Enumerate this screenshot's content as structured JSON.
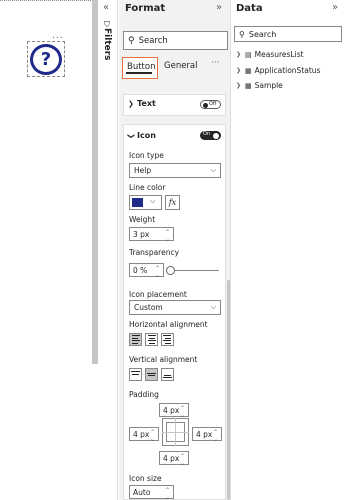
{
  "canvas": {
    "visual_more": "...",
    "help_glyph": "?"
  },
  "filters": {
    "collapse_glyph": "«",
    "label": "Filters",
    "icon_glyph": "⛉"
  },
  "format_pane": {
    "title": "Format",
    "expand_glyph": "»",
    "search_placeholder": "Search",
    "tabs": [
      {
        "label": "Button",
        "selected": true
      },
      {
        "label": "General",
        "selected": false
      }
    ],
    "more_glyph": "···",
    "text_card": {
      "label": "Text",
      "toggle": "Off"
    },
    "icon_card": {
      "label": "Icon",
      "toggle": "On",
      "icon_type": {
        "label": "Icon type",
        "value": "Help"
      },
      "line_color": {
        "label": "Line color",
        "color": "#1f2a8a",
        "fx_label": "fx"
      },
      "weight": {
        "label": "Weight",
        "value": "3 px"
      },
      "transparency": {
        "label": "Transparency",
        "value": "0 %",
        "level": 0
      },
      "icon_placement": {
        "label": "Icon placement",
        "value": "Custom"
      },
      "horizontal_alignment": {
        "label": "Horizontal alignment",
        "selected": "left"
      },
      "vertical_alignment": {
        "label": "Vertical alignment",
        "selected": "middle"
      },
      "padding": {
        "label": "Padding",
        "top": "4 px",
        "left": "4 px",
        "right": "4 px",
        "bottom": "4 px"
      },
      "icon_size": {
        "label": "Icon size",
        "value": "Auto"
      }
    }
  },
  "data_pane": {
    "title": "Data",
    "expand_glyph": "»",
    "search_placeholder": "Search",
    "items": [
      {
        "label": "MeasuresList",
        "icon": "measure-table-icon"
      },
      {
        "label": "ApplicationStatus",
        "icon": "table-icon"
      },
      {
        "label": "Sample",
        "icon": "table-icon"
      }
    ]
  },
  "colors": {
    "accent_tab_border": "#e8733a",
    "icon_color": "#1f2a8a"
  }
}
